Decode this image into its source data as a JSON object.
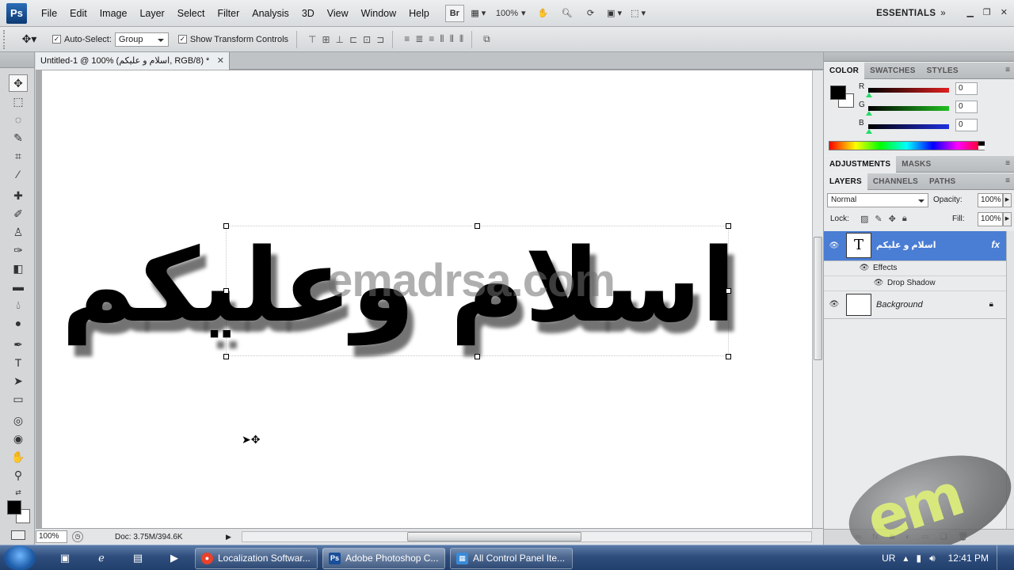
{
  "app": {
    "logo": "Ps",
    "menu": [
      "File",
      "Edit",
      "Image",
      "Layer",
      "Select",
      "Filter",
      "Analysis",
      "3D",
      "View",
      "Window",
      "Help"
    ],
    "bridge_label": "Br",
    "zoom_menu": "100%",
    "workspace": "ESSENTIALS"
  },
  "options": {
    "auto_select_label": "Auto-Select:",
    "auto_select_checked": true,
    "auto_select_value": "Group",
    "transform_controls_label": "Show Transform Controls",
    "transform_controls_checked": true
  },
  "document": {
    "tab_title": "Untitled-1 @ 100% (اسلام و علیکم, RGB/8) *",
    "text_layer_content": "اسلام وعلیکم",
    "watermark_text": "emadrsa.com"
  },
  "status": {
    "zoom": "100%",
    "doc_size": "Doc: 3.75M/394.6K"
  },
  "color_panel": {
    "tabs": [
      "COLOR",
      "SWATCHES",
      "STYLES"
    ],
    "active_tab": "COLOR",
    "channels": [
      {
        "label": "R",
        "value": "0",
        "color": "#e02020"
      },
      {
        "label": "G",
        "value": "0",
        "color": "#20c020"
      },
      {
        "label": "B",
        "value": "0",
        "color": "#2030e0"
      }
    ]
  },
  "adjust_panel": {
    "tabs": [
      "ADJUSTMENTS",
      "MASKS"
    ],
    "active_tab": "ADJUSTMENTS"
  },
  "layers_panel": {
    "tabs": [
      "LAYERS",
      "CHANNELS",
      "PATHS"
    ],
    "active_tab": "LAYERS",
    "blend_mode": "Normal",
    "opacity_label": "Opacity:",
    "opacity": "100%",
    "lock_label": "Lock:",
    "fill_label": "Fill:",
    "fill": "100%",
    "layers": [
      {
        "name": "اسلام و علیکم",
        "type": "text",
        "selected": true,
        "thumb": "T",
        "fx": "fx"
      },
      {
        "name": "Background",
        "type": "background",
        "selected": false,
        "locked": true
      }
    ],
    "effects_label": "Effects",
    "effect_items": [
      "Drop Shadow"
    ]
  },
  "watermark_logo": "em",
  "taskbar": {
    "buttons": [
      {
        "label": "Localization Softwar...",
        "icon": "chrome-icon",
        "active": false
      },
      {
        "label": "Adobe Photoshop C...",
        "icon": "photoshop-icon",
        "active": true
      },
      {
        "label": "All Control Panel Ite...",
        "icon": "control-panel-icon",
        "active": false
      }
    ],
    "language": "UR",
    "time": "12:41 PM"
  }
}
